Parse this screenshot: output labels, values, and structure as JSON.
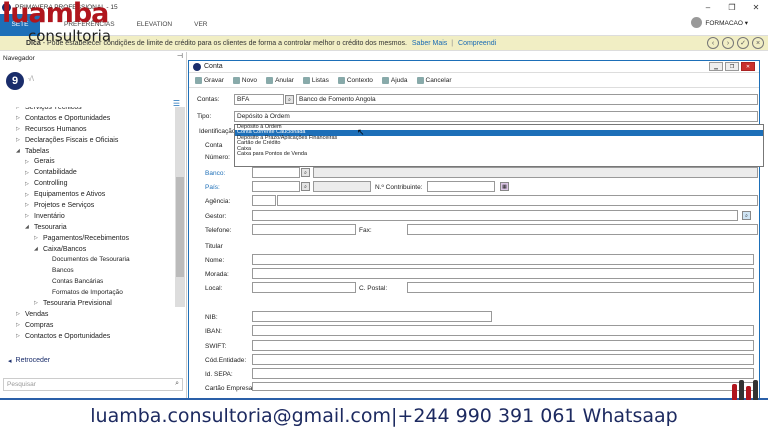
{
  "app": {
    "title": "PRIMAVERA PROFESSIONAL - 15",
    "icon": "primavera-logo-icon"
  },
  "watermark": {
    "big": "luamba",
    "small": "consultoria"
  },
  "window_controls": [
    "–",
    "❐",
    "✕"
  ],
  "menubar": {
    "file": "SETE",
    "items": [
      "PREFERÊNCIAS",
      "ELEVATION",
      "VER"
    ],
    "user": "FORMACAO ▾"
  },
  "tip": {
    "bold": "Dica",
    "text": " - Pode estabelecer condições de limite de crédito para os clientes de forma a controlar melhor o crédito dos mesmos.",
    "link1": "Saber Mais",
    "sep": "|",
    "link2": "Compreendi"
  },
  "navigator": {
    "title": "Navegador",
    "logo_letter": "9",
    "logo_sub": "√\\",
    "tree": [
      {
        "label": "Serviços Técnicos",
        "level": 1,
        "arrow": "▷",
        "bold": false
      },
      {
        "label": "Contactos e Oportunidades",
        "level": 1,
        "arrow": "▷",
        "bold": false
      },
      {
        "label": "Recursos Humanos",
        "level": 1,
        "arrow": "▷",
        "bold": false
      },
      {
        "label": "Declarações Fiscais e Oficiais",
        "level": 1,
        "arrow": "▷",
        "bold": false
      },
      {
        "label": "Tabelas",
        "level": 1,
        "arrow": "◢",
        "bold": false
      },
      {
        "label": "Gerais",
        "level": 2,
        "arrow": "▷",
        "bold": false
      },
      {
        "label": "Contabilidade",
        "level": 2,
        "arrow": "▷",
        "bold": false
      },
      {
        "label": "Controlling",
        "level": 2,
        "arrow": "▷",
        "bold": false
      },
      {
        "label": "Equipamentos e Ativos",
        "level": 2,
        "arrow": "▷",
        "bold": false
      },
      {
        "label": "Projetos e Serviços",
        "level": 2,
        "arrow": "▷",
        "bold": false
      },
      {
        "label": "Inventário",
        "level": 2,
        "arrow": "▷",
        "bold": false
      },
      {
        "label": "Tesouraria",
        "level": 2,
        "arrow": "◢",
        "bold": false
      },
      {
        "label": "Pagamentos/Recebimentos",
        "level": 3,
        "arrow": "▷",
        "bold": false
      },
      {
        "label": "Caixa/Bancos",
        "level": 3,
        "arrow": "◢",
        "bold": false
      },
      {
        "label": "Documentos de Tesouraria",
        "level": 4,
        "arrow": "",
        "bold": false
      },
      {
        "label": "Bancos",
        "level": 4,
        "arrow": "",
        "bold": false
      },
      {
        "label": "Contas Bancárias",
        "level": 4,
        "arrow": "",
        "bold": false
      },
      {
        "label": "Formatos de Importação",
        "level": 4,
        "arrow": "",
        "bold": false
      },
      {
        "label": "Tesouraria Previsional",
        "level": 3,
        "arrow": "▷",
        "bold": false
      },
      {
        "label": "Vendas",
        "level": 1,
        "arrow": "▷",
        "bold": false
      },
      {
        "label": "Compras",
        "level": 1,
        "arrow": "▷",
        "bold": false
      },
      {
        "label": "Contactos e Oportunidades",
        "level": 1,
        "arrow": "▷",
        "bold": false
      }
    ],
    "back": "Retroceder",
    "search_placeholder": "Pesquisar"
  },
  "conta": {
    "title": "Conta",
    "toolbar": [
      "Gravar",
      "Novo",
      "Anular",
      "Listas",
      "Contexto",
      "Ajuda",
      "Cancelar"
    ],
    "labels": {
      "contas": "Contas:",
      "tipo": "Tipo:",
      "identificacao": "Identificação",
      "conta": "Conta",
      "numero": "Número:",
      "banco": "Banco:",
      "pais": "País:",
      "contribuinte": "N.º Contribuinte:",
      "agencia": "Agência:",
      "gestor": "Gestor:",
      "telefone": "Telefone:",
      "fax": "Fax:",
      "titular": "Titular",
      "nome": "Nome:",
      "morada": "Morada:",
      "local": "Local:",
      "cpostal": "C. Postal:",
      "nib": "NIB:",
      "iban": "IBAN:",
      "swift": "SWIFT:",
      "entidade": "Cód.Entidade:",
      "sepa": "Id. SEPA:",
      "cartao": "Cartão Empresa:"
    },
    "values": {
      "conta_code": "BFA",
      "conta_name": "Banco de Fomento Angola",
      "tipo": "Depósito à Ordem"
    },
    "tipo_options": [
      "Depósito à Ordem",
      "Conta Corrente Caucionada",
      "Depósito a Prazo/Aplicações Financeiras",
      "Cartão de Crédito",
      "Caixa",
      "Caixa para Pontos de Venda"
    ],
    "selected_option": 1
  },
  "footer": {
    "contact": "luamba.consultoria@gmail.com|+244 990 391 061 Whatsaap"
  }
}
